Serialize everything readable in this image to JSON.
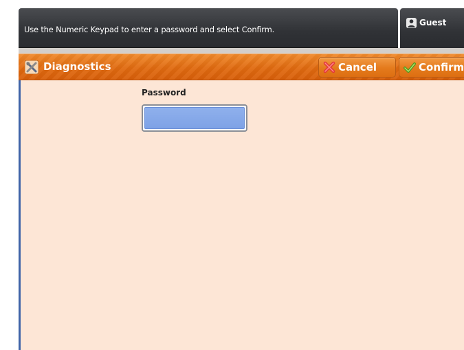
{
  "header": {
    "message": "Use the Numeric Keypad to enter a password and select Confirm.",
    "user_label": "Guest",
    "user_icon": "user-icon"
  },
  "titlebar": {
    "title": "Diagnostics",
    "title_icon": "tools-icon",
    "cancel_label": "Cancel",
    "cancel_icon": "x-icon",
    "confirm_label": "Confirm",
    "confirm_icon": "checkmark-icon"
  },
  "form": {
    "password_label": "Password",
    "password_value": ""
  },
  "colors": {
    "accent": "#e0700f",
    "content_bg": "#fde6d6",
    "field_fill": "#86a9ea",
    "header_bg": "#303236"
  }
}
